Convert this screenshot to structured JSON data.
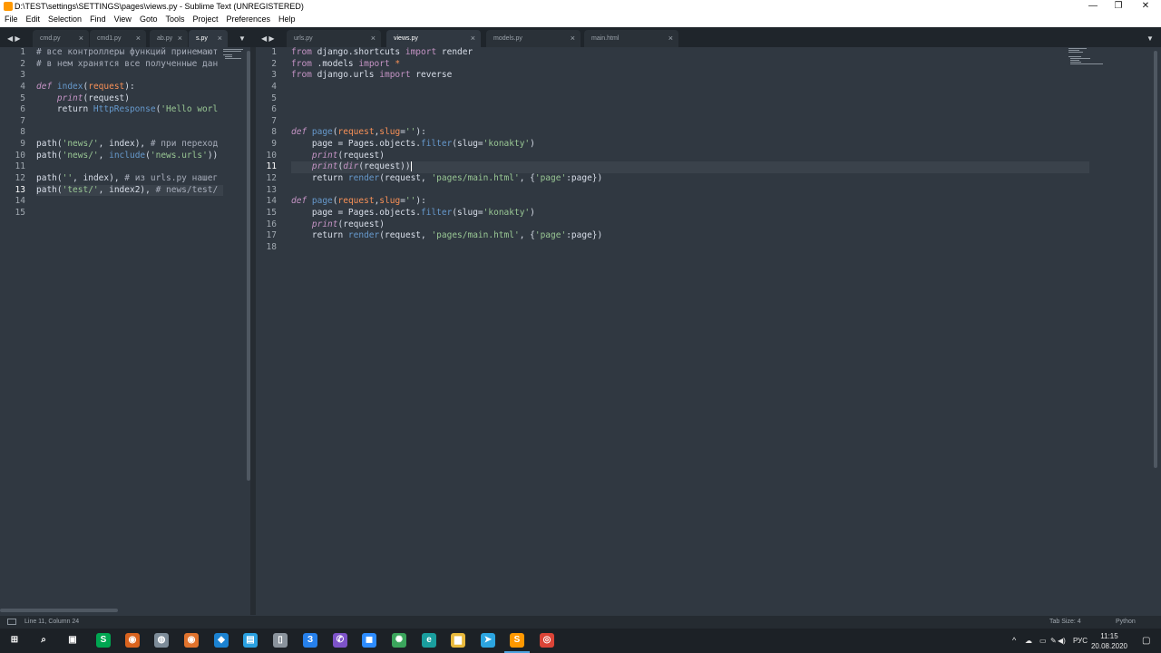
{
  "window": {
    "title": "D:\\TEST\\settings\\SETTINGS\\pages\\views.py - Sublime Text (UNREGISTERED)",
    "minimize": "—",
    "maximize": "❐",
    "close": "✕"
  },
  "menu": [
    "File",
    "Edit",
    "Selection",
    "Find",
    "View",
    "Goto",
    "Tools",
    "Project",
    "Preferences",
    "Help"
  ],
  "left_tabs": [
    {
      "label": "cmd.py",
      "active": false
    },
    {
      "label": "cmd1.py",
      "active": false
    },
    {
      "label": "ab.py",
      "active": false
    },
    {
      "label": "s.py",
      "active": true
    }
  ],
  "right_tabs": [
    {
      "label": "urls.py",
      "active": false
    },
    {
      "label": "views.py",
      "active": true
    },
    {
      "label": "models.py",
      "active": false
    },
    {
      "label": "main.html",
      "active": false
    }
  ],
  "nav_arrows": "◀ ▶",
  "tab_dropdown": "▼",
  "left_editor": {
    "line_numbers": [
      "1",
      "2",
      "3",
      "4",
      "5",
      "6",
      "7",
      "8",
      "9",
      "10",
      "11",
      "12",
      "13",
      "14",
      "15"
    ],
    "current_line": 13,
    "lines": [
      [
        {
          "c": "cm",
          "t": "# все контроллеры функций принемают"
        }
      ],
      [
        {
          "c": "cm",
          "t": "# в нем хранятся все полученные дан"
        }
      ],
      [],
      [
        {
          "c": "it",
          "t": "def "
        },
        {
          "c": "fn",
          "t": "index"
        },
        {
          "c": "",
          "t": "("
        },
        {
          "c": "org",
          "t": "request"
        },
        {
          "c": "",
          "t": "):"
        }
      ],
      [
        {
          "c": "",
          "t": "    "
        },
        {
          "c": "it",
          "t": "print"
        },
        {
          "c": "",
          "t": "(request)"
        }
      ],
      [
        {
          "c": "",
          "t": "    return "
        },
        {
          "c": "fn",
          "t": "HttpResponse"
        },
        {
          "c": "",
          "t": "("
        },
        {
          "c": "str",
          "t": "'Hello worl"
        }
      ],
      [],
      [],
      [
        {
          "c": "",
          "t": "path("
        },
        {
          "c": "str",
          "t": "'news/'"
        },
        {
          "c": "",
          "t": ", index), "
        },
        {
          "c": "cm",
          "t": "# при переход"
        }
      ],
      [
        {
          "c": "",
          "t": "path("
        },
        {
          "c": "str",
          "t": "'news/'"
        },
        {
          "c": "",
          "t": ", "
        },
        {
          "c": "fn",
          "t": "include"
        },
        {
          "c": "",
          "t": "("
        },
        {
          "c": "str",
          "t": "'news.urls'"
        },
        {
          "c": "",
          "t": "))"
        }
      ],
      [],
      [
        {
          "c": "",
          "t": "path("
        },
        {
          "c": "str",
          "t": "''"
        },
        {
          "c": "",
          "t": ", index), "
        },
        {
          "c": "cm",
          "t": "# из urls.py нашег"
        }
      ],
      [
        {
          "c": "",
          "t": "path("
        },
        {
          "c": "str",
          "t": "'test/'"
        },
        {
          "c": "",
          "t": ", index2), "
        },
        {
          "c": "cm",
          "t": "# news/test/"
        }
      ],
      [],
      []
    ]
  },
  "right_editor": {
    "line_numbers": [
      "1",
      "2",
      "3",
      "4",
      "5",
      "6",
      "7",
      "8",
      "9",
      "10",
      "11",
      "12",
      "13",
      "14",
      "15",
      "16",
      "17",
      "18"
    ],
    "current_line": 11,
    "lines": [
      [
        {
          "c": "kw",
          "t": "from "
        },
        {
          "c": "",
          "t": "django.shortcuts "
        },
        {
          "c": "kw",
          "t": "import "
        },
        {
          "c": "",
          "t": "render"
        }
      ],
      [
        {
          "c": "kw",
          "t": "from "
        },
        {
          "c": "",
          "t": ".models "
        },
        {
          "c": "kw",
          "t": "import "
        },
        {
          "c": "org",
          "t": "*"
        }
      ],
      [
        {
          "c": "kw",
          "t": "from "
        },
        {
          "c": "",
          "t": "django.urls "
        },
        {
          "c": "kw",
          "t": "import "
        },
        {
          "c": "",
          "t": "reverse"
        }
      ],
      [],
      [],
      [],
      [],
      [
        {
          "c": "it",
          "t": "def "
        },
        {
          "c": "fn",
          "t": "page"
        },
        {
          "c": "",
          "t": "("
        },
        {
          "c": "org",
          "t": "request"
        },
        {
          "c": "",
          "t": ","
        },
        {
          "c": "org",
          "t": "slug"
        },
        {
          "c": "",
          "t": "="
        },
        {
          "c": "str",
          "t": "''"
        },
        {
          "c": "",
          "t": "):"
        }
      ],
      [
        {
          "c": "",
          "t": "    page = Pages.objects."
        },
        {
          "c": "fn",
          "t": "filter"
        },
        {
          "c": "",
          "t": "(slug="
        },
        {
          "c": "str",
          "t": "'konakty'"
        },
        {
          "c": "",
          "t": ")"
        }
      ],
      [
        {
          "c": "",
          "t": "    "
        },
        {
          "c": "it",
          "t": "print"
        },
        {
          "c": "",
          "t": "(request)"
        }
      ],
      [
        {
          "c": "",
          "t": "    "
        },
        {
          "c": "it",
          "t": "print"
        },
        {
          "c": "",
          "t": "("
        },
        {
          "c": "it",
          "t": "dir"
        },
        {
          "c": "",
          "t": "(request))"
        }
      ],
      [
        {
          "c": "",
          "t": "    return "
        },
        {
          "c": "fn",
          "t": "render"
        },
        {
          "c": "",
          "t": "(request, "
        },
        {
          "c": "str",
          "t": "'pages/main.html'"
        },
        {
          "c": "",
          "t": ", {"
        },
        {
          "c": "str",
          "t": "'page'"
        },
        {
          "c": "",
          "t": ":page})"
        }
      ],
      [],
      [
        {
          "c": "it",
          "t": "def "
        },
        {
          "c": "fn",
          "t": "page"
        },
        {
          "c": "",
          "t": "("
        },
        {
          "c": "org",
          "t": "request"
        },
        {
          "c": "",
          "t": ","
        },
        {
          "c": "org",
          "t": "slug"
        },
        {
          "c": "",
          "t": "="
        },
        {
          "c": "str",
          "t": "''"
        },
        {
          "c": "",
          "t": "):"
        }
      ],
      [
        {
          "c": "",
          "t": "    page = Pages.objects."
        },
        {
          "c": "fn",
          "t": "filter"
        },
        {
          "c": "",
          "t": "(slug="
        },
        {
          "c": "str",
          "t": "'konakty'"
        },
        {
          "c": "",
          "t": ")"
        }
      ],
      [
        {
          "c": "",
          "t": "    "
        },
        {
          "c": "it",
          "t": "print"
        },
        {
          "c": "",
          "t": "(request)"
        }
      ],
      [
        {
          "c": "",
          "t": "    return "
        },
        {
          "c": "fn",
          "t": "render"
        },
        {
          "c": "",
          "t": "(request, "
        },
        {
          "c": "str",
          "t": "'pages/main.html'"
        },
        {
          "c": "",
          "t": ", {"
        },
        {
          "c": "str",
          "t": "'page'"
        },
        {
          "c": "",
          "t": ":page})"
        }
      ],
      []
    ]
  },
  "status": {
    "position": "Line 11, Column 24",
    "tab_size": "Tab Size: 4",
    "syntax": "Python"
  },
  "taskbar": {
    "icons": [
      {
        "name": "windows-start-icon",
        "glyph": "⊞",
        "color": "#1c2126"
      },
      {
        "name": "search-icon",
        "glyph": "⌕",
        "color": "#1c2126"
      },
      {
        "name": "task-view-icon",
        "glyph": "▣",
        "color": "#1c2126"
      },
      {
        "name": "skype-icon",
        "glyph": "S",
        "color": "#00a651"
      },
      {
        "name": "app-orange-icon",
        "glyph": "◉",
        "color": "#d9631e"
      },
      {
        "name": "app-gray-icon",
        "glyph": "◍",
        "color": "#7d8c99"
      },
      {
        "name": "app-fox-icon",
        "glyph": "◉",
        "color": "#e0732d"
      },
      {
        "name": "app-blue-icon",
        "glyph": "◆",
        "color": "#1b82d1"
      },
      {
        "name": "app-monitor-icon",
        "glyph": "▤",
        "color": "#2aa0e0"
      },
      {
        "name": "app-phone-icon",
        "glyph": "▯",
        "color": "#8a939c"
      },
      {
        "name": "app-three-icon",
        "glyph": "З",
        "color": "#2680eb"
      },
      {
        "name": "viber-icon",
        "glyph": "✆",
        "color": "#7d53c9"
      },
      {
        "name": "zoom-icon",
        "glyph": "◼",
        "color": "#2d8cff"
      },
      {
        "name": "app-globe-icon",
        "glyph": "✺",
        "color": "#3ba55c"
      },
      {
        "name": "app-e-icon",
        "glyph": "e",
        "color": "#1a9e9e"
      },
      {
        "name": "file-explorer-icon",
        "glyph": "▆",
        "color": "#e8b93c"
      },
      {
        "name": "telegram-icon",
        "glyph": "➤",
        "color": "#2ca5e0"
      },
      {
        "name": "sublime-icon",
        "glyph": "S",
        "color": "#ff9800"
      },
      {
        "name": "chrome-icon",
        "glyph": "◎",
        "color": "#db4437"
      }
    ],
    "tray": {
      "chevron": "^",
      "icons": [
        "☁",
        "▭",
        "✎",
        "◀)"
      ],
      "lang": "РУС",
      "time": "11:15",
      "date": "20.08.2020",
      "notif": "▢"
    }
  }
}
